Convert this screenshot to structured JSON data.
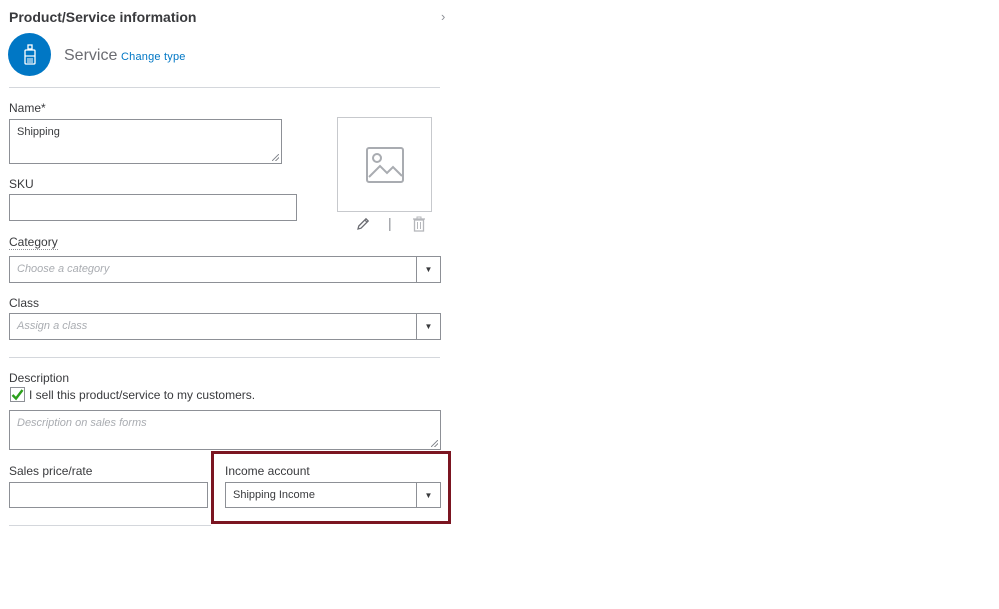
{
  "panel": {
    "title": "Product/Service information",
    "close_glyph": "›"
  },
  "type": {
    "icon": "service-bell-icon",
    "label": "Service",
    "change_link": "Change type"
  },
  "fields": {
    "name": {
      "label": "Name*",
      "value": "Shipping"
    },
    "sku": {
      "label": "SKU",
      "value": ""
    },
    "category": {
      "label": "Category",
      "placeholder": "Choose a category"
    },
    "class": {
      "label": "Class",
      "placeholder": "Assign a class"
    },
    "description": {
      "label": "Description",
      "checkbox_label": "I sell this product/service to my customers.",
      "checked": true,
      "placeholder": "Description on sales forms"
    },
    "sales_price": {
      "label": "Sales price/rate",
      "value": ""
    },
    "income_account": {
      "label": "Income account",
      "value": "Shipping Income"
    }
  },
  "image": {
    "icon": "image-placeholder-icon",
    "edit_icon": "pencil-icon",
    "separator": "|",
    "delete_icon": "trash-icon"
  },
  "colors": {
    "accent": "#0077c5",
    "highlight_border": "#7b1521",
    "check_green": "#2ca01c"
  }
}
